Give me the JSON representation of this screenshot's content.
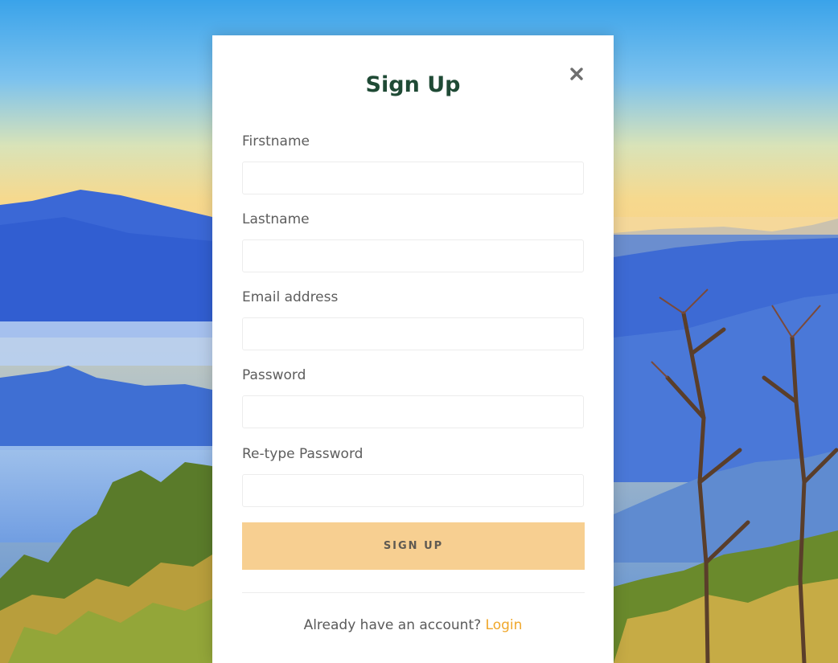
{
  "modal": {
    "title": "Sign Up",
    "close_icon": "close-icon"
  },
  "form": {
    "fields": [
      {
        "label": "Firstname",
        "value": "",
        "placeholder": ""
      },
      {
        "label": "Lastname",
        "value": "",
        "placeholder": ""
      },
      {
        "label": "Email address",
        "value": "",
        "placeholder": ""
      },
      {
        "label": "Password",
        "value": "",
        "placeholder": ""
      },
      {
        "label": "Re-type Password",
        "value": "",
        "placeholder": ""
      }
    ],
    "submit_label": "SIGN UP"
  },
  "footer": {
    "prompt": "Already have an account?",
    "login_link": "Login"
  },
  "colors": {
    "title": "#1f4a35",
    "button_bg": "#f7cf91",
    "link": "#f0a72a"
  }
}
